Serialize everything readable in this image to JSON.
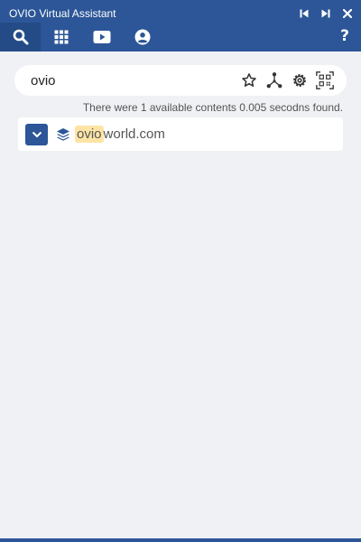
{
  "window": {
    "title": "OVIO Virtual Assistant"
  },
  "window_controls": [
    {
      "name": "skip-previous-icon"
    },
    {
      "name": "skip-next-icon"
    },
    {
      "name": "close-icon"
    }
  ],
  "nav": {
    "tabs": [
      {
        "name": "search-icon",
        "active": true
      },
      {
        "name": "apps-grid-icon",
        "active": false
      },
      {
        "name": "video-camera-icon",
        "active": false
      },
      {
        "name": "account-icon",
        "active": false
      }
    ],
    "help_label": "?"
  },
  "search": {
    "value": "ovio",
    "tools": [
      "star-icon",
      "network-icon",
      "gear-icon",
      "qr-code-icon"
    ]
  },
  "results": {
    "info": "There were 1 available contents 0.005 secodns found.",
    "items": [
      {
        "highlight": "ovio",
        "rest": "world.com"
      }
    ]
  },
  "colors": {
    "header": "#2c5697",
    "background": "#eff1f4",
    "highlight": "#fde4a5"
  }
}
